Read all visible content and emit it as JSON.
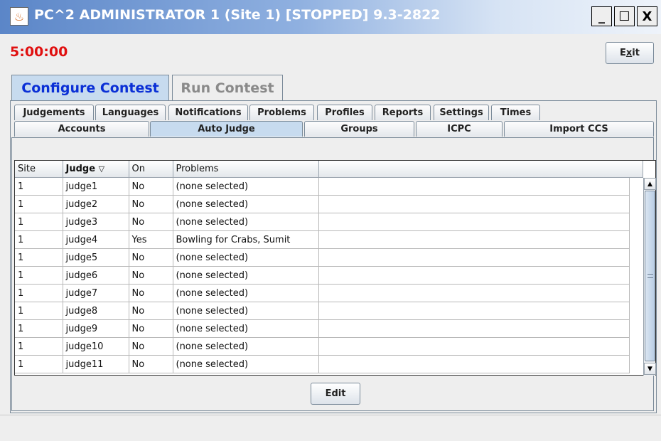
{
  "window": {
    "title": "PC^2 ADMINISTRATOR 1 (Site 1) [STOPPED] 9.3-2822",
    "icon": "java-cup-icon",
    "controls": {
      "minimize": "_",
      "maximize": "☐",
      "close": "X"
    }
  },
  "clock": "5:00:00",
  "exit_button": {
    "pre": "E",
    "mnemonic": "x",
    "post": "it"
  },
  "main_tabs": [
    {
      "label": "Configure Contest",
      "selected": true
    },
    {
      "label": "Run Contest",
      "selected": false
    }
  ],
  "sub_tabs_row1": [
    {
      "label": "Judgements"
    },
    {
      "label": "Languages"
    },
    {
      "label": "Notifications"
    },
    {
      "label": "Problems"
    },
    {
      "label": "Profiles"
    },
    {
      "label": "Reports"
    },
    {
      "label": "Settings"
    },
    {
      "label": "Times"
    }
  ],
  "sub_tabs_row2": [
    {
      "label": "Accounts",
      "selected": false
    },
    {
      "label": "Auto Judge",
      "selected": true
    },
    {
      "label": "Groups",
      "selected": false
    },
    {
      "label": "ICPC",
      "selected": false
    },
    {
      "label": "Import CCS",
      "selected": false
    }
  ],
  "table": {
    "columns": [
      "Site",
      "Judge",
      "On",
      "Problems",
      ""
    ],
    "sort_indicator": "▽",
    "rows": [
      [
        "1",
        "judge1",
        "No",
        "(none selected)"
      ],
      [
        "1",
        "judge2",
        "No",
        "(none selected)"
      ],
      [
        "1",
        "judge3",
        "No",
        "(none selected)"
      ],
      [
        "1",
        "judge4",
        "Yes",
        "Bowling for Crabs, Sumit"
      ],
      [
        "1",
        "judge5",
        "No",
        "(none selected)"
      ],
      [
        "1",
        "judge6",
        "No",
        "(none selected)"
      ],
      [
        "1",
        "judge7",
        "No",
        "(none selected)"
      ],
      [
        "1",
        "judge8",
        "No",
        "(none selected)"
      ],
      [
        "1",
        "judge9",
        "No",
        "(none selected)"
      ],
      [
        "1",
        "judge10",
        "No",
        "(none selected)"
      ],
      [
        "1",
        "judge11",
        "No",
        "(none selected)"
      ]
    ]
  },
  "scrollbar": {
    "up": "▲",
    "down": "▼"
  },
  "edit_button": "Edit",
  "colors": {
    "clock": "#e01010",
    "selected_tab_text": "#0a2fd6",
    "selected_tab_bg": "#c7dbef"
  }
}
